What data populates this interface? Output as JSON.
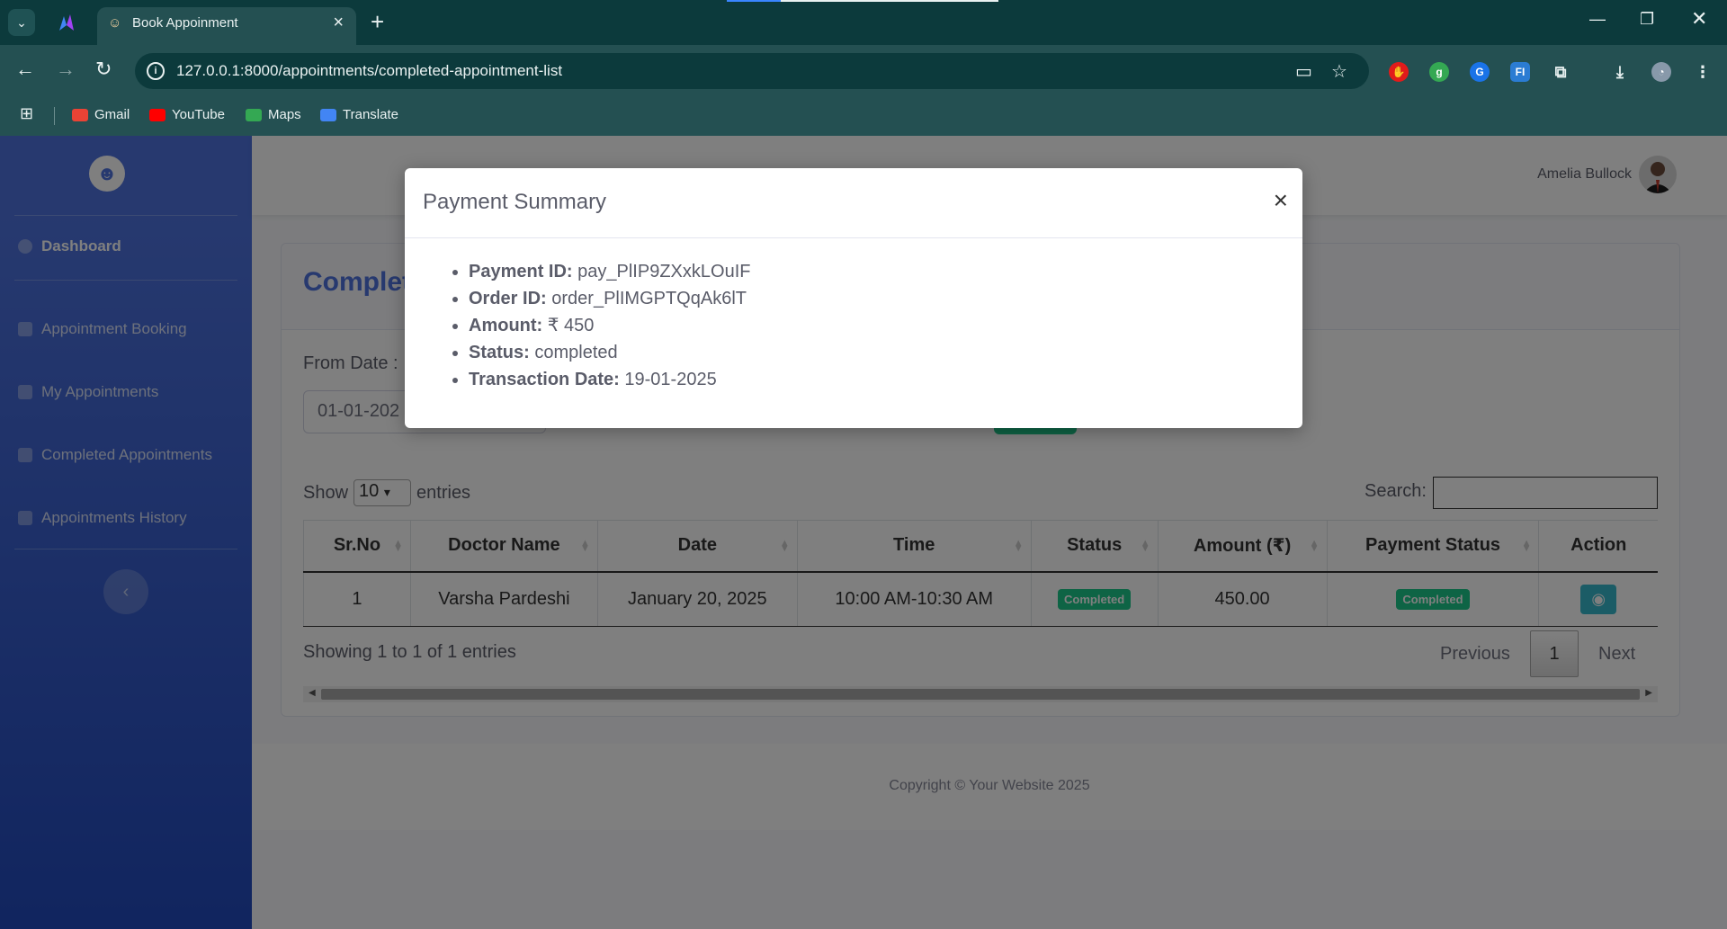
{
  "browser": {
    "tab_title": "Book Appoinment",
    "url": "127.0.0.1:8000/appointments/completed-appointment-list",
    "bookmarks": [
      {
        "label": "Gmail",
        "color": "#ea4335"
      },
      {
        "label": "YouTube",
        "color": "#ff0000"
      },
      {
        "label": "Maps",
        "color": "#34a853"
      },
      {
        "label": "Translate",
        "color": "#4285f4"
      }
    ]
  },
  "sidebar": {
    "items": [
      {
        "label": "Dashboard"
      },
      {
        "label": "Appointment Booking"
      },
      {
        "label": "My Appointments"
      },
      {
        "label": "Completed Appointments"
      },
      {
        "label": "Appointments History"
      }
    ],
    "toggle_icon": "‹"
  },
  "topbar": {
    "user_name": "Amelia Bullock"
  },
  "card": {
    "title": "Complet",
    "from_date_label": "From Date :",
    "from_date_value": "01-01-202"
  },
  "datatable": {
    "show_label": "Show",
    "entries_label": "entries",
    "page_length": "10",
    "search_label": "Search:",
    "columns": [
      "Sr.No",
      "Doctor Name",
      "Date",
      "Time",
      "Status",
      "Amount (₹)",
      "Payment Status",
      "Action"
    ],
    "rows": [
      {
        "sr_no": "1",
        "doctor_name": "Varsha Pardeshi",
        "date": "January 20, 2025",
        "time": "10:00 AM-10:30 AM",
        "status": "Completed",
        "amount": "450.00",
        "payment_status": "Completed"
      }
    ],
    "info": "Showing 1 to 1 of 1 entries",
    "prev_label": "Previous",
    "current_page": "1",
    "next_label": "Next"
  },
  "footer": {
    "copyright": "Copyright © Your Website 2025"
  },
  "modal": {
    "title": "Payment Summary",
    "close": "×",
    "fields": [
      {
        "label": "Payment ID:",
        "value": "pay_PlIP9ZXxkLOuIF"
      },
      {
        "label": "Order ID:",
        "value": "order_PlIMGPTQqAk6lT"
      },
      {
        "label": "Amount:",
        "value": "₹ 450"
      },
      {
        "label": "Status:",
        "value": "completed"
      },
      {
        "label": "Transaction Date:",
        "value": "19-01-2025"
      }
    ]
  },
  "colors": {
    "chrome": "#0c3a3c",
    "sidebar": "#4e73df",
    "badge": "#1cc88a",
    "view_button": "#36b9cc"
  }
}
